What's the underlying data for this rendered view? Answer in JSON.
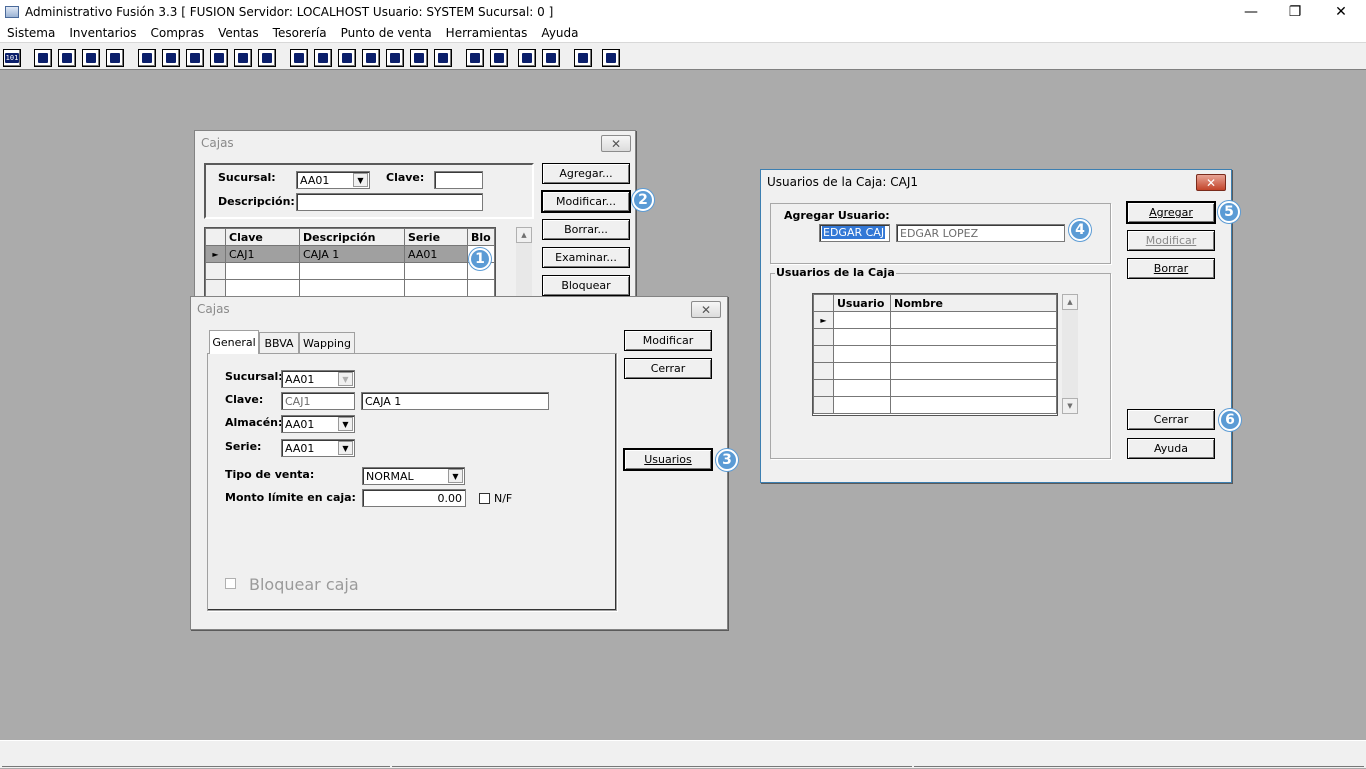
{
  "app": {
    "title": "Administrativo Fusión 3.3 [ FUSION  Servidor: LOCALHOST   Usuario: SYSTEM    Sucursal: 0 ]",
    "window_controls": {
      "minimize": "—",
      "restore": "❐",
      "close": "✕"
    }
  },
  "menu": [
    "Sistema",
    "Inventarios",
    "Compras",
    "Ventas",
    "Tesorería",
    "Punto de venta",
    "Herramientas",
    "Ayuda"
  ],
  "toolbar": {
    "first_icon_text": "101"
  },
  "cajas_list": {
    "title": "Cajas",
    "sucursal_label": "Sucursal:",
    "sucursal_value": "AA01",
    "clave_label": "Clave:",
    "clave_value": "",
    "descripcion_label": "Descripción:",
    "descripcion_value": "",
    "buttons": {
      "agregar": "Agregar...",
      "modificar": "Modificar...",
      "borrar": "Borrar...",
      "examinar": "Examinar...",
      "bloquear": "Bloquear"
    },
    "columns": [
      "Clave",
      "Descripción",
      "Serie",
      "Blo"
    ],
    "rows": [
      {
        "clave": "CAJ1",
        "descripcion": "CAJA 1",
        "serie": "AA01",
        "blo": ""
      }
    ]
  },
  "cajas_edit": {
    "title": "Cajas",
    "tabs": [
      "General",
      "BBVA",
      "Wapping"
    ],
    "sucursal_label": "Sucursal:",
    "sucursal_value": "AA01",
    "clave_label": "Clave:",
    "clave_value": "CAJ1",
    "descripcion_value": "CAJA 1",
    "almacen_label": "Almacén:",
    "almacen_value": "AA01",
    "serie_label": "Serie:",
    "serie_value": "AA01",
    "tipo_venta_label": "Tipo de venta:",
    "tipo_venta_value": "NORMAL",
    "monto_label": "Monto límite en caja:",
    "monto_value": "0.00",
    "nf_label": "N/F",
    "bloquear_label": "Bloquear caja",
    "buttons": {
      "modificar": "Modificar",
      "cerrar": "Cerrar",
      "usuarios": "Usuarios"
    }
  },
  "usuarios_caja": {
    "title": "Usuarios de la Caja: CAJ1",
    "agregar_usuario_label": "Agregar Usuario:",
    "usuario_value": "EDGAR CAJ",
    "nombre_value": "EDGAR LOPEZ",
    "group_title": "Usuarios de la Caja",
    "columns": [
      "Usuario",
      "Nombre"
    ],
    "buttons": {
      "agregar": "Agregar",
      "modificar": "Modificar",
      "borrar": "Borrar",
      "cerrar": "Cerrar",
      "ayuda": "Ayuda"
    }
  },
  "badges": [
    "1",
    "2",
    "3",
    "4",
    "5",
    "6"
  ],
  "colors": {
    "badge": "#5b9bd5",
    "desktop": "#ababab",
    "selected_row": "#a0a0a0"
  }
}
